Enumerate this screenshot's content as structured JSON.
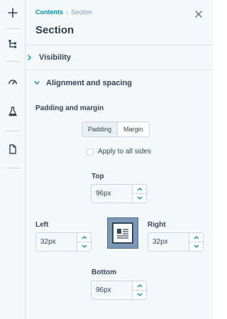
{
  "breadcrumb": {
    "parent": "Contents",
    "current": "Section"
  },
  "panel": {
    "title": "Section"
  },
  "accordions": [
    {
      "label": "Visibility",
      "expanded": false
    },
    {
      "label": "Alignment and spacing",
      "expanded": true
    }
  ],
  "spacing": {
    "heading": "Padding and margin",
    "tabs": [
      "Padding",
      "Margin"
    ],
    "active_tab": "Padding",
    "apply_all_label": "Apply to all sides",
    "apply_all_checked": false,
    "top": {
      "label": "Top",
      "value": "96px"
    },
    "left": {
      "label": "Left",
      "value": "32px"
    },
    "right": {
      "label": "Right",
      "value": "32px"
    },
    "bottom": {
      "label": "Bottom",
      "value": "96px"
    }
  },
  "rail_icons": [
    "plus-icon",
    "tree-icon",
    "gauge-icon",
    "flask-icon",
    "document-icon"
  ],
  "colors": {
    "accent": "#0091ae",
    "text": "#33475b",
    "panel_bg": "#f5f8fa",
    "border": "#cbd6e2"
  }
}
